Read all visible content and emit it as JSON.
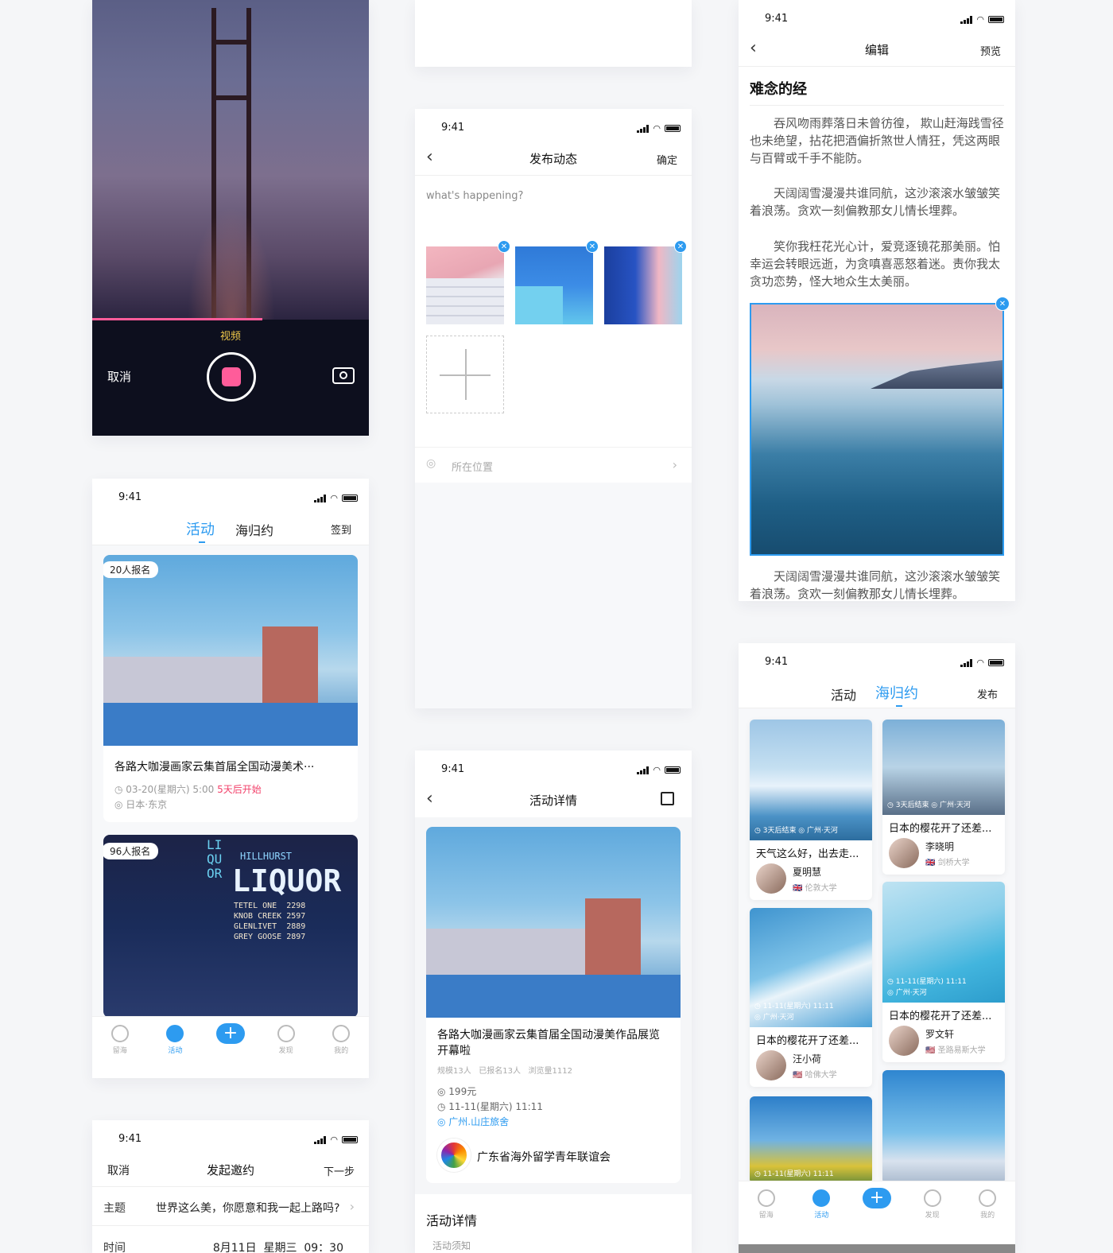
{
  "status": {
    "time": "9:41"
  },
  "camera": {
    "mode": "视频",
    "cancel": "取消"
  },
  "compose": {
    "title": "发布动态",
    "confirm": "确定",
    "placeholder": "what's happening?",
    "location": "所在位置"
  },
  "editor": {
    "title": "编辑",
    "preview": "预览",
    "doc_title": "难念的经",
    "paragraphs": [
      "吞风吻雨葬落日未曾彷徨， 欺山赶海践雪径也未绝望，拈花把酒偏折煞世人情狂，凭这两眼与百臂或千手不能防。",
      "天阔阔雪漫漫共谁同航，这沙滚滚水皱皱笑着浪荡。贪欢一刻偏教那女儿情长埋葬。",
      "笑你我枉花光心计，爱竞逐镜花那美丽。怕幸运会转眼远逝，为贪嗔喜恶怒着迷。责你我太贪功恋势，怪大地众生太美丽。"
    ],
    "after": "天阔阔雪漫漫共谁同航，这沙滚滚水皱皱笑着浪荡。贪欢一刻偏教那女儿情长埋葬。"
  },
  "activity": {
    "tab_active": "活动",
    "tab_other": "海归约",
    "right": "签到",
    "cards": [
      {
        "badge": "20人报名",
        "title": "各路大咖漫画家云集首届全国动漫美术···",
        "date": "03-20(星期六) 5:00",
        "countdown": "5天后开始",
        "place": "日本·东京"
      },
      {
        "badge": "96人报名"
      }
    ],
    "sign": {
      "title": "HILLHURST",
      "big": "LIQUOR",
      "rows": [
        "TETEL ONE  2298",
        "KNOB CREEK 2597",
        "GLENLIVET  2889",
        "GREY GOOSE 2897"
      ],
      "side": "LIQUOR"
    }
  },
  "tabbar": {
    "items": [
      "留海",
      "活动",
      "发现",
      "我的"
    ]
  },
  "invite": {
    "cancel": "取消",
    "title": "发起邀约",
    "next": "下一步",
    "topic_label": "主题",
    "topic_value": "世界这么美，你愿意和我一起上路吗?",
    "time_label": "时间",
    "time_value": "8月11日  星期三  09：30"
  },
  "detail": {
    "title": "活动详情",
    "event_title": "各路大咖漫画家云集首届全国动漫美作品展览开幕啦",
    "stats": "规模13人   已报名13人   浏览量1112",
    "price": "199元",
    "time": "11-11(星期六) 11:11",
    "place": "广州.山庄旅舍",
    "org": "广东省海外留学青年联谊会",
    "section": "活动详情",
    "sub": "活动须知"
  },
  "haigui": {
    "tab_other": "活动",
    "tab_active": "海归约",
    "right": "发布",
    "cards": [
      {
        "meta": "◷ 3天后结束  ◎ 广州·天河",
        "title": "天气这么好，出去走...",
        "name": "夏明慧",
        "school": "🇬🇧 伦敦大学"
      },
      {
        "meta": "◷ 3天后结束  ◎ 广州·天河",
        "title": "日本的樱花开了还差...",
        "name": "李晓明",
        "school": "🇬🇧 剑桥大学"
      },
      {
        "meta": "◷ 11-11(星期六) 11:11\n◎ 广州·天河",
        "title": "日本的樱花开了还差...",
        "name": "汪小荷",
        "school": "🇺🇸 哈佛大学"
      },
      {
        "meta": "◷ 11-11(星期六) 11:11\n◎ 广州·天河",
        "title": "日本的樱花开了还差...",
        "name": "罗文轩",
        "school": "🇺🇸 圣路易斯大学"
      },
      {
        "meta": "◷ 11-11(星期六) 11:11"
      },
      {
        "meta": ""
      }
    ]
  }
}
